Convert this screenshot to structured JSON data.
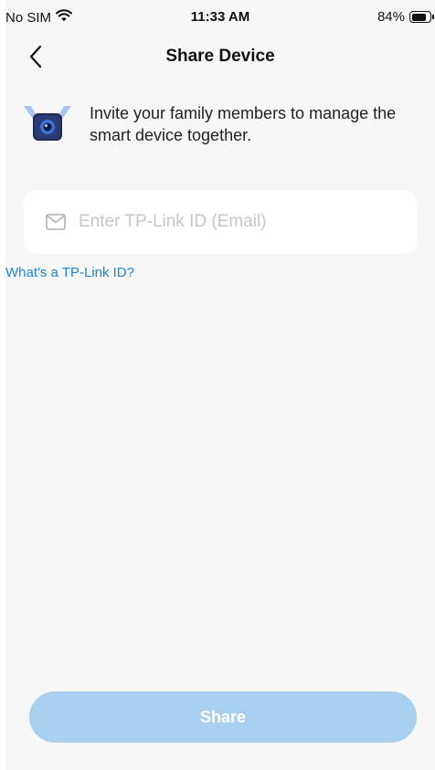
{
  "status_bar": {
    "carrier": "No SIM",
    "time": "11:33 AM",
    "battery_text": "84%",
    "battery_level": 0.84
  },
  "nav": {
    "title": "Share Device"
  },
  "intro": {
    "text": "Invite your family members to manage the smart device together."
  },
  "email_field": {
    "placeholder": "Enter TP-Link ID (Email)",
    "value": ""
  },
  "help_link": {
    "label": "What's a TP-Link ID?"
  },
  "share_button": {
    "label": "Share",
    "enabled": false
  },
  "colors": {
    "accent": "#1a87cf",
    "button_disabled": "#a8d0ee",
    "background": "#f7f7f7"
  }
}
